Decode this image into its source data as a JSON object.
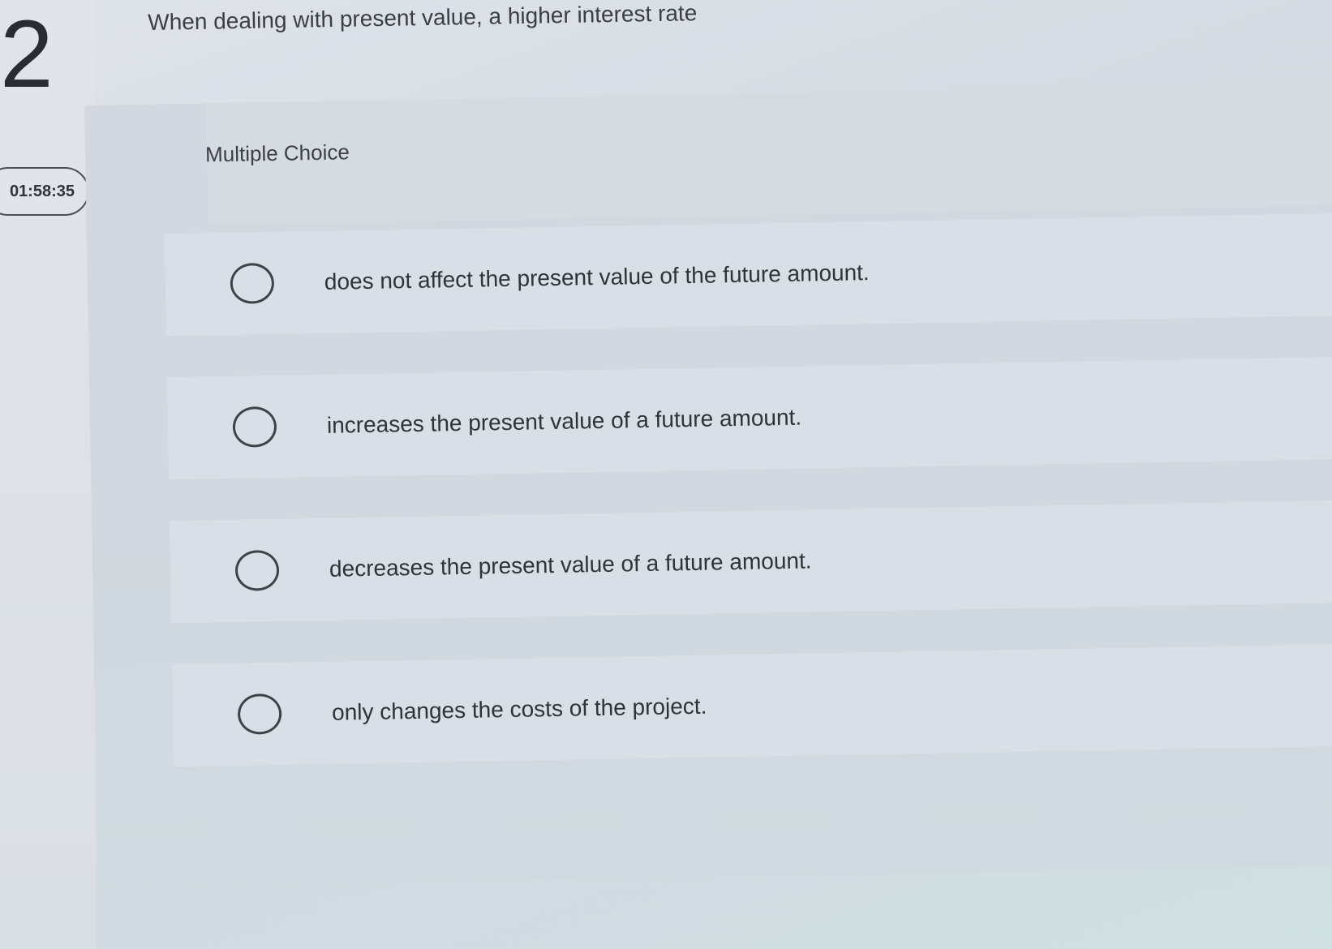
{
  "question": {
    "number": "2",
    "text": "When dealing with present value, a higher interest rate"
  },
  "timer": {
    "value": "01:58:35"
  },
  "choice_area": {
    "type_label": "Multiple Choice",
    "options": [
      {
        "label": "does not affect the present value of the future amount."
      },
      {
        "label": "increases the present value of a future amount."
      },
      {
        "label": "decreases the present value of a future amount."
      },
      {
        "label": "only changes the costs of the project."
      }
    ]
  },
  "colors": {
    "text": "#2f333a",
    "panel": "#d3d8e0",
    "option_background": "#d9dfe6",
    "radio_border": "#3e424a"
  }
}
